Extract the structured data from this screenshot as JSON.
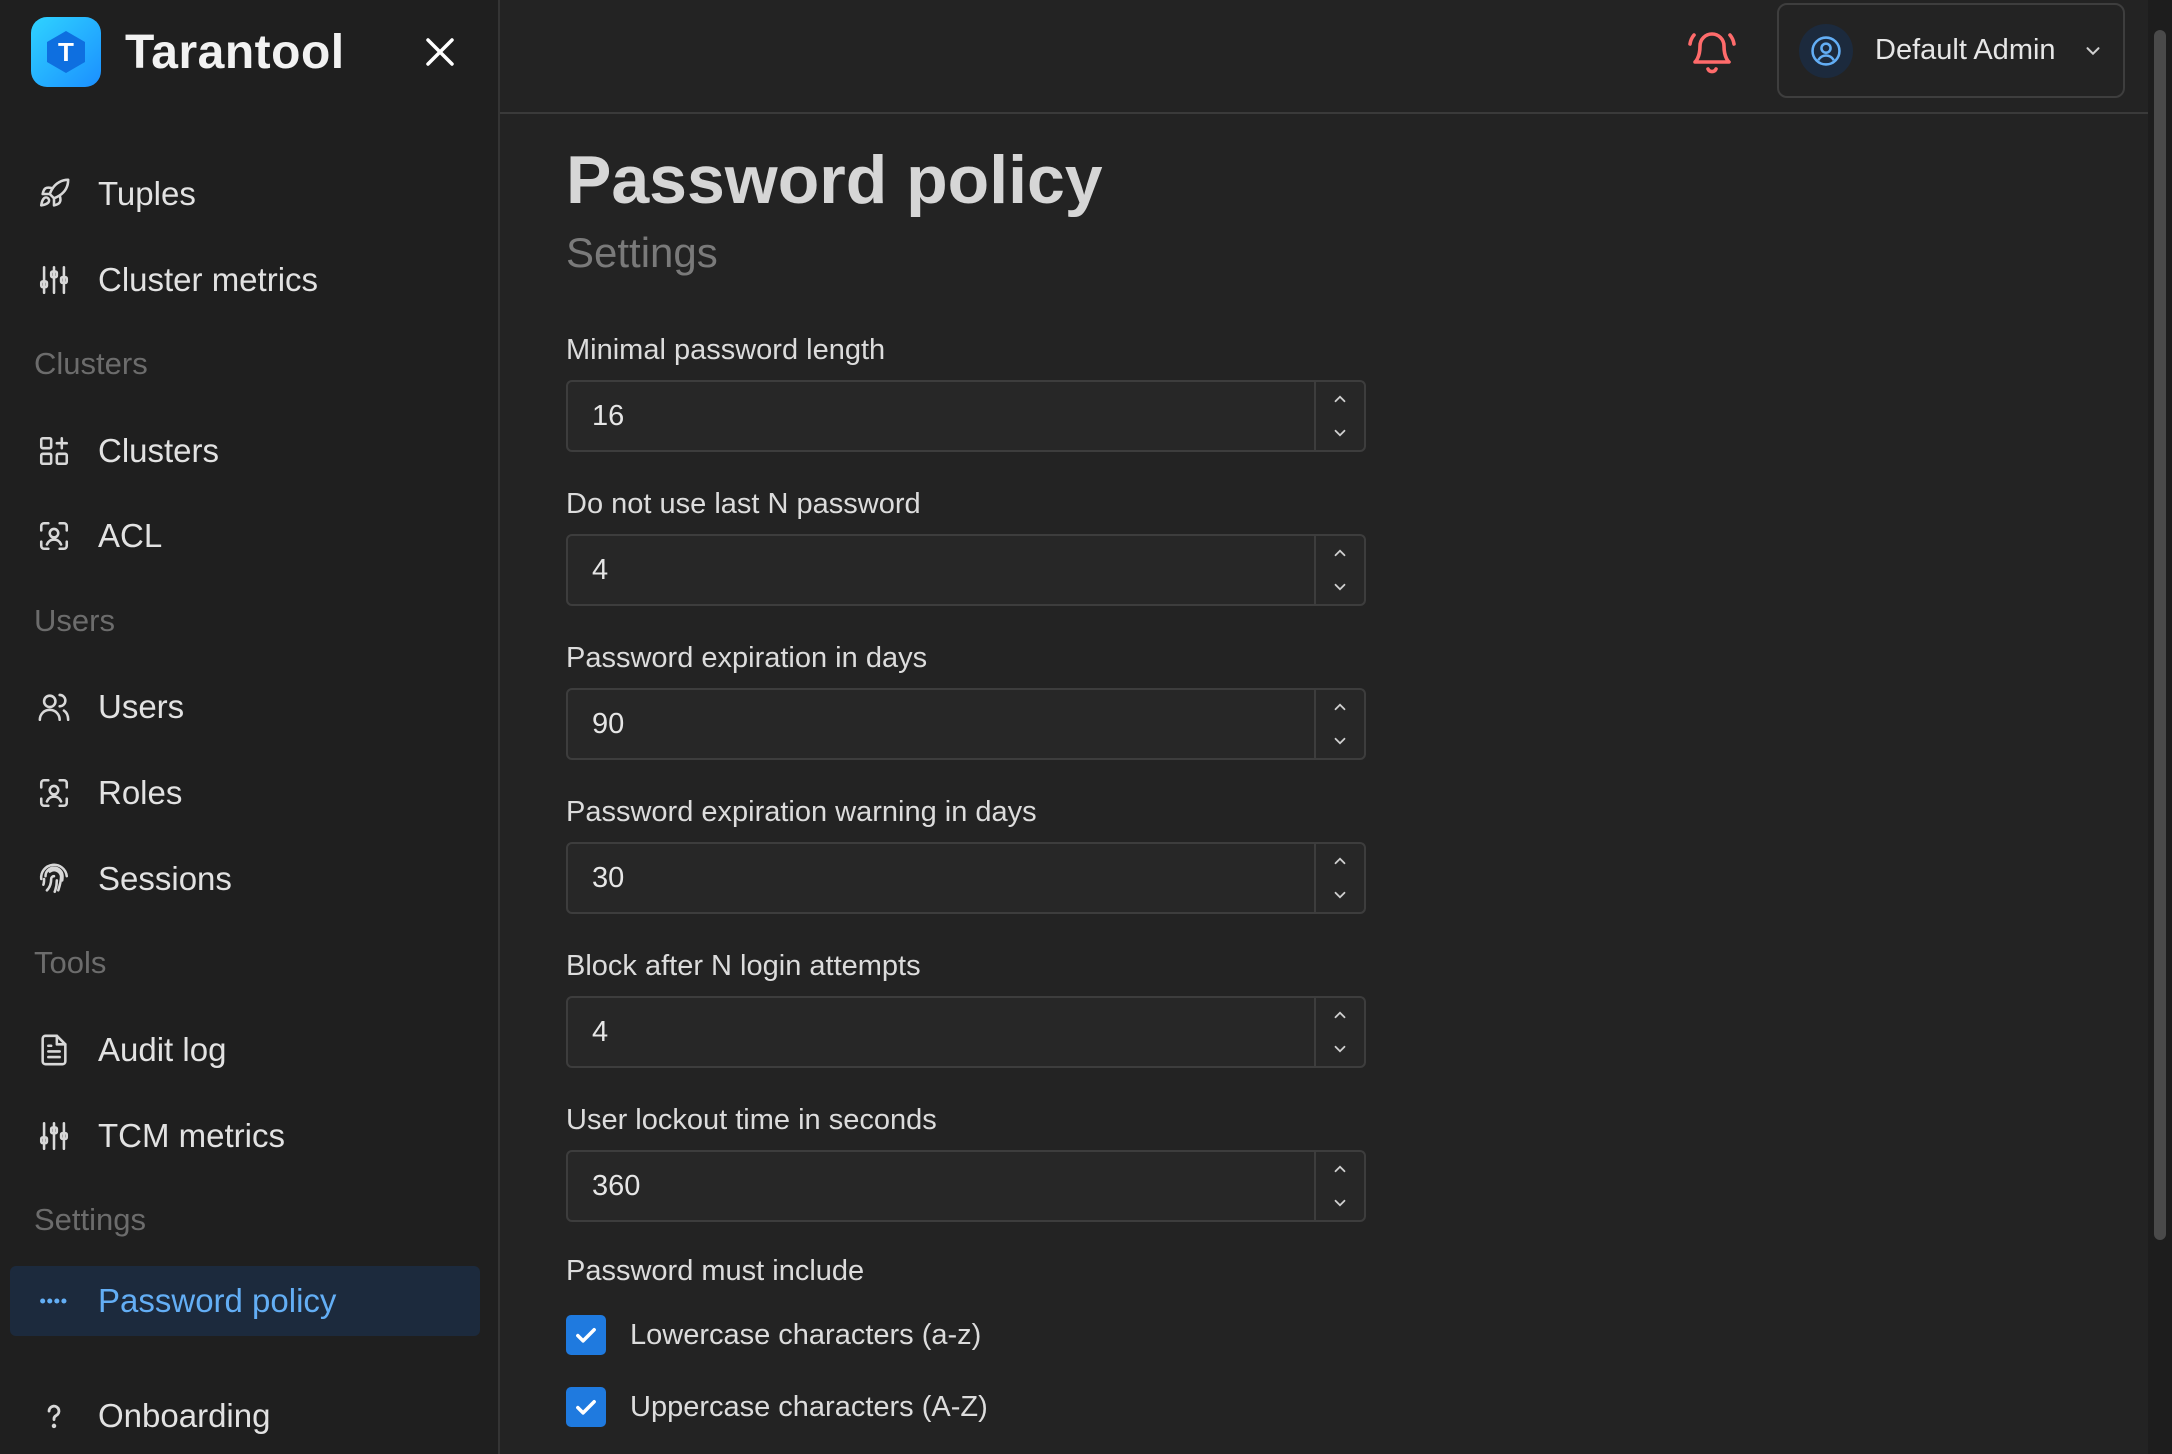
{
  "app": {
    "brand": "Tarantool",
    "logo_letter": "T"
  },
  "sidebar": {
    "items_top": [
      {
        "label": "Tuples",
        "icon": "rocket-icon"
      },
      {
        "label": "Cluster metrics",
        "icon": "sliders-icon"
      }
    ],
    "sections": {
      "clusters": "Clusters",
      "users": "Users",
      "tools": "Tools",
      "settings": "Settings"
    },
    "clusters_items": [
      {
        "label": "Clusters",
        "icon": "grid-plus-icon"
      },
      {
        "label": "ACL",
        "icon": "user-scan-icon"
      }
    ],
    "users_items": [
      {
        "label": "Users",
        "icon": "users-icon"
      },
      {
        "label": "Roles",
        "icon": "user-scan-icon"
      },
      {
        "label": "Sessions",
        "icon": "fingerprint-icon"
      }
    ],
    "tools_items": [
      {
        "label": "Audit log",
        "icon": "document-icon"
      },
      {
        "label": "TCM metrics",
        "icon": "sliders-icon"
      }
    ],
    "settings_items": [
      {
        "label": "Password policy",
        "icon": "password-dots-icon",
        "active": true
      }
    ],
    "footer_items": [
      {
        "label": "Onboarding",
        "icon": "question-icon"
      }
    ]
  },
  "header": {
    "user_name": "Default Admin",
    "bell_color": "#ff6b6b"
  },
  "page": {
    "title": "Password policy",
    "subtitle": "Settings"
  },
  "fields": [
    {
      "label": "Minimal password length",
      "value": "16"
    },
    {
      "label": "Do not use last N password",
      "value": "4"
    },
    {
      "label": "Password expiration in days",
      "value": "90"
    },
    {
      "label": "Password expiration warning in days",
      "value": "30"
    },
    {
      "label": "Block after N login attempts",
      "value": "4"
    },
    {
      "label": "User lockout time in seconds",
      "value": "360"
    }
  ],
  "must_include": {
    "label": "Password must include",
    "options": [
      {
        "label": "Lowercase characters (a-z)",
        "checked": true
      },
      {
        "label": "Uppercase characters (A-Z)",
        "checked": true
      }
    ]
  },
  "colors": {
    "accent": "#1f7adf",
    "active_text": "#63aef5",
    "active_bg": "#1c2a3d"
  }
}
